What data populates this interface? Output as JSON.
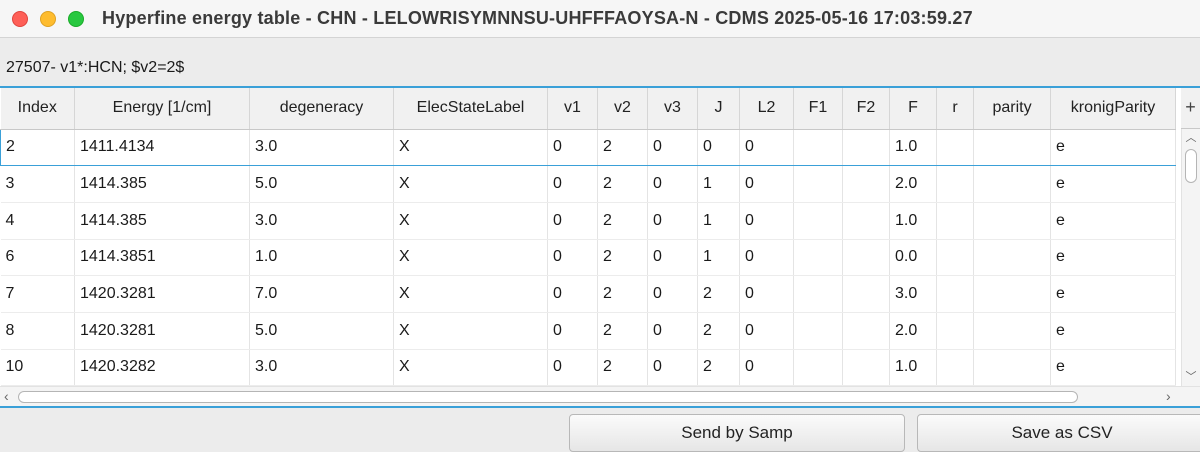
{
  "window": {
    "title": "Hyperfine energy table - CHN - LELOWRISYMNNSU-UHFFFAOYSA-N - CDMS 2025-05-16 17:03:59.27"
  },
  "subtitle": "27507- v1*:HCN; $v2=2$",
  "table": {
    "columns": [
      "Index",
      "Energy  [1/cm]",
      "degeneracy",
      "ElecStateLabel",
      "v1",
      "v2",
      "v3",
      "J",
      "L2",
      "F1",
      "F2",
      "F",
      "r",
      "parity",
      "kronigParity"
    ],
    "rows": [
      [
        "2",
        "1411.4134",
        "3.0",
        "X",
        "0",
        "2",
        "0",
        "0",
        "0",
        "",
        "",
        "1.0",
        "",
        "",
        "e"
      ],
      [
        "3",
        "1414.385",
        "5.0",
        "X",
        "0",
        "2",
        "0",
        "1",
        "0",
        "",
        "",
        "2.0",
        "",
        "",
        "e"
      ],
      [
        "4",
        "1414.385",
        "3.0",
        "X",
        "0",
        "2",
        "0",
        "1",
        "0",
        "",
        "",
        "1.0",
        "",
        "",
        "e"
      ],
      [
        "6",
        "1414.3851",
        "1.0",
        "X",
        "0",
        "2",
        "0",
        "1",
        "0",
        "",
        "",
        "0.0",
        "",
        "",
        "e"
      ],
      [
        "7",
        "1420.3281",
        "7.0",
        "X",
        "0",
        "2",
        "0",
        "2",
        "0",
        "",
        "",
        "3.0",
        "",
        "",
        "e"
      ],
      [
        "8",
        "1420.3281",
        "5.0",
        "X",
        "0",
        "2",
        "0",
        "2",
        "0",
        "",
        "",
        "2.0",
        "",
        "",
        "e"
      ],
      [
        "10",
        "1420.3282",
        "3.0",
        "X",
        "0",
        "2",
        "0",
        "2",
        "0",
        "",
        "",
        "1.0",
        "",
        "",
        "e"
      ]
    ],
    "selected_row_index": 0,
    "corner_icon": "plus-icon"
  },
  "buttons": {
    "send_samp": "Send by Samp",
    "save_csv": "Save as CSV"
  },
  "colors": {
    "accent": "#3aa0d8",
    "close": "#fe5f57",
    "minimize": "#febc2e",
    "maximize": "#28c840"
  }
}
